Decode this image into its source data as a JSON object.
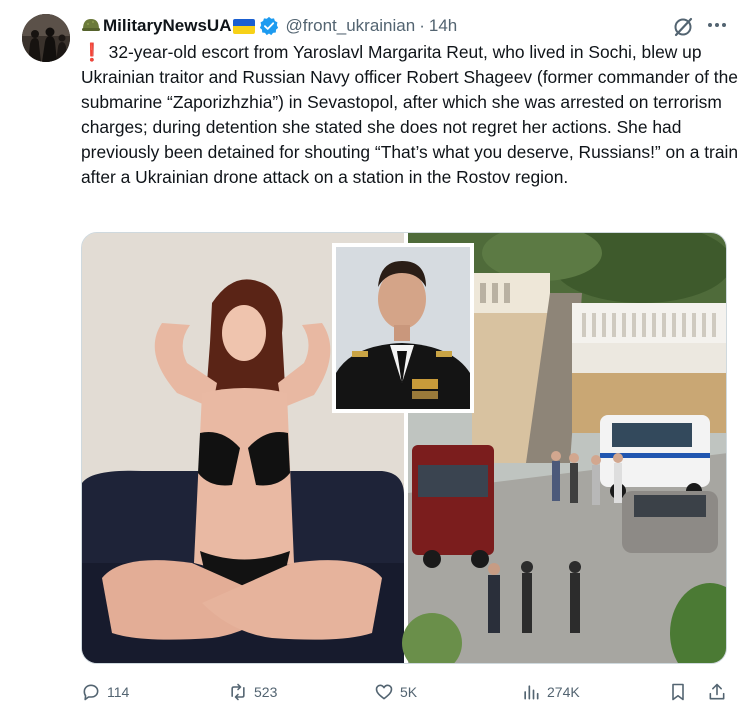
{
  "author": {
    "display_name": "MilitaryNewsUA",
    "handle": "@front_ukrainian",
    "separator": "·",
    "time": "14h",
    "verified": true,
    "flag_colors": [
      "#1a5fd0",
      "#f7d117"
    ]
  },
  "tweet": {
    "alert_glyph": "❗",
    "text": "32-year-old escort from Yaroslavl Margarita Reut, who lived in Sochi, blew up Ukrainian traitor and Russian Navy officer Robert Shageev (former commander of the submarine “Zaporizhzhia”) in Sevastopol, after which she was arrested on terrorism charges; during detention she stated she does not regret her actions. She had previously been detained for shouting “That’s what you deserve, Russians!” on a train after a Ukrainian drone attack on a station in the Rostov region."
  },
  "icons": {
    "avatar": "avatar-soldiers",
    "helmet": "military-helmet-icon",
    "verified": "verified-badge-icon",
    "grok": "grok-icon",
    "more": "more-icon",
    "reply": "reply-icon",
    "retweet": "retweet-icon",
    "like": "heart-icon",
    "views": "views-icon",
    "bookmark": "bookmark-icon",
    "share": "share-icon"
  },
  "stats": {
    "replies": "114",
    "retweets": "523",
    "likes": "5K",
    "views": "274K"
  },
  "colors": {
    "text": "#0f1419",
    "secondary": "#536471",
    "verified": "#1d9bf0",
    "alert": "#d41a1a"
  }
}
